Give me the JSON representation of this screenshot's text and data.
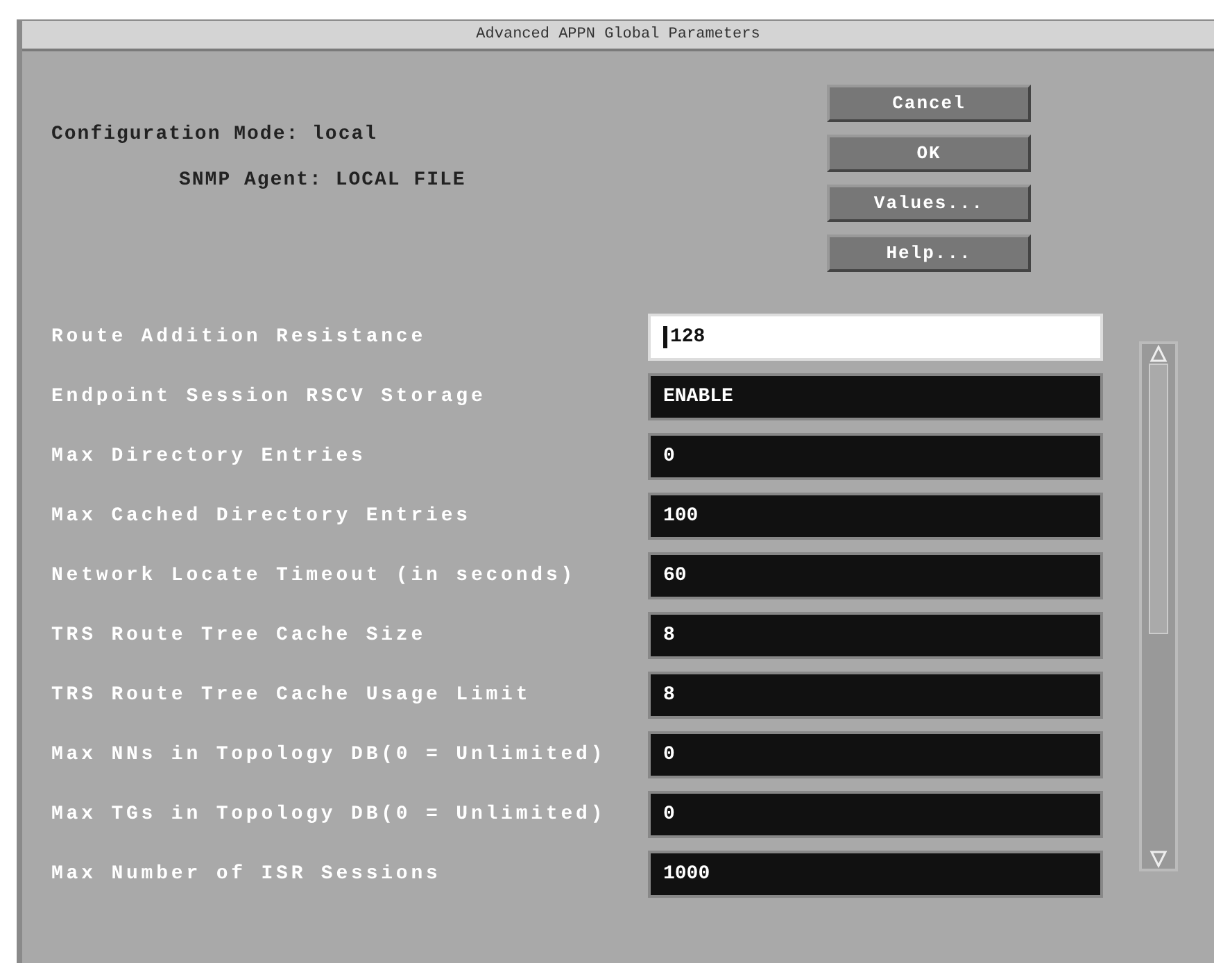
{
  "window": {
    "title": "Advanced APPN Global Parameters"
  },
  "info": {
    "mode": "Configuration Mode: local",
    "agent": "SNMP Agent: LOCAL FILE"
  },
  "buttons": [
    "Cancel",
    "OK",
    "Values...",
    "Help..."
  ],
  "parameters": [
    {
      "label": "Route Addition Resistance",
      "value": "128",
      "focused": true
    },
    {
      "label": "Endpoint Session RSCV Storage",
      "value": "ENABLE",
      "focused": false
    },
    {
      "label": "Max Directory Entries",
      "value": "0",
      "focused": false
    },
    {
      "label": "Max Cached Directory Entries",
      "value": "100",
      "focused": false
    },
    {
      "label": "Network Locate Timeout (in seconds)",
      "value": "60",
      "focused": false
    },
    {
      "label": "TRS Route Tree Cache Size",
      "value": "8",
      "focused": false
    },
    {
      "label": "TRS Route Tree Cache Usage Limit",
      "value": "8",
      "focused": false
    },
    {
      "label": "Max NNs in Topology DB(0 = Unlimited)",
      "value": "0",
      "focused": false
    },
    {
      "label": "Max TGs in Topology DB(0 = Unlimited)",
      "value": "0",
      "focused": false
    },
    {
      "label": "Max Number of ISR Sessions",
      "value": "1000",
      "focused": false
    }
  ]
}
